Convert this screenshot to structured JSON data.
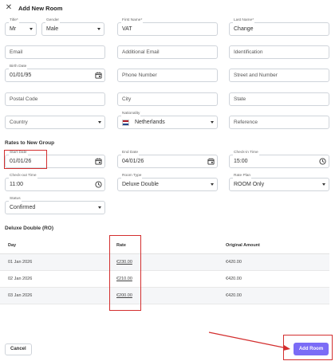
{
  "header": {
    "close_icon": "close-icon",
    "title": "Add New Room"
  },
  "guest": {
    "title": {
      "label": "Title*",
      "value": "Mr"
    },
    "gender": {
      "label": "Gender",
      "value": "Male"
    },
    "first_name": {
      "label": "First Name*",
      "value": "VAT"
    },
    "last_name": {
      "label": "Last Name*",
      "value": "Change"
    },
    "email": {
      "placeholder": "Email"
    },
    "additional_email": {
      "placeholder": "Additional Email"
    },
    "identification": {
      "placeholder": "Identification"
    },
    "birth_date": {
      "label": "Birth Date",
      "value": "01/01/95"
    },
    "phone": {
      "placeholder": "Phone Number"
    },
    "street": {
      "placeholder": "Street and Number"
    },
    "postal_code": {
      "placeholder": "Postal Code"
    },
    "city": {
      "placeholder": "City"
    },
    "state": {
      "placeholder": "State"
    },
    "country": {
      "placeholder": "Country"
    },
    "nationality": {
      "label": "Nationality",
      "value": "Netherlands"
    },
    "reference": {
      "placeholder": "Reference"
    }
  },
  "rates_section": {
    "heading": "Rates to New Group",
    "start_date": {
      "label": "Start Date",
      "value": "01/01/26"
    },
    "end_date": {
      "label": "End Date",
      "value": "04/01/26"
    },
    "check_in": {
      "label": "Check-in Time",
      "value": "15:00"
    },
    "check_out": {
      "label": "Check-out Time",
      "value": "11:00"
    },
    "room_type": {
      "label": "Room Type",
      "value": "Deluxe Double"
    },
    "rate_plan": {
      "label": "Rate Plan",
      "value": "ROOM Only"
    },
    "status": {
      "label": "Status",
      "value": "Confirmed"
    }
  },
  "room_table": {
    "heading": "Deluxe Double (RO)",
    "columns": [
      "Day",
      "Rate",
      "Original Amount"
    ],
    "rows": [
      {
        "day": "01 Jan 2026",
        "rate": "€230.00",
        "original": "€420.00"
      },
      {
        "day": "02 Jan 2026",
        "rate": "€210.00",
        "original": "€420.00"
      },
      {
        "day": "03 Jan 2026",
        "rate": "€200.00",
        "original": "€420.00"
      }
    ]
  },
  "footer": {
    "cancel_label": "Cancel",
    "add_room_label": "Add Room"
  },
  "colors": {
    "accent": "#7b6cf6",
    "highlight": "#d32f2f",
    "border": "#cfd4da"
  }
}
